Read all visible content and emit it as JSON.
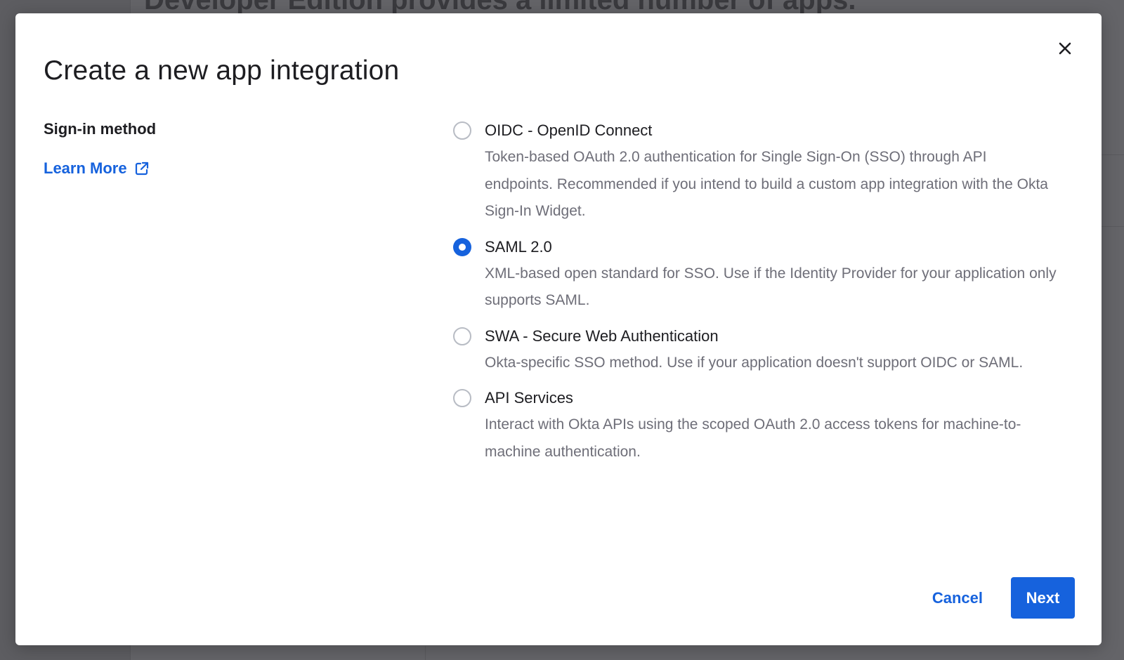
{
  "background": {
    "heading": "Developer Edition provides a limited number of apps."
  },
  "modal": {
    "title": "Create a new app integration",
    "close_icon": "close-icon",
    "sign_in": {
      "label": "Sign-in method",
      "learn_more": "Learn More",
      "learn_more_icon": "external-link-icon"
    },
    "options": [
      {
        "label": "OIDC - OpenID Connect",
        "description": "Token-based OAuth 2.0 authentication for Single Sign-On (SSO) through API endpoints. Recommended if you intend to build a custom app integration with the Okta Sign-In Widget.",
        "selected": false
      },
      {
        "label": "SAML 2.0",
        "description": "XML-based open standard for SSO. Use if the Identity Provider for your application only supports SAML.",
        "selected": true
      },
      {
        "label": "SWA - Secure Web Authentication",
        "description": "Okta-specific SSO method. Use if your application doesn't support OIDC or SAML.",
        "selected": false
      },
      {
        "label": "API Services",
        "description": "Interact with Okta APIs using the scoped OAuth 2.0 access tokens for machine-to-machine authentication.",
        "selected": false
      }
    ],
    "footer": {
      "cancel_label": "Cancel",
      "next_label": "Next"
    }
  },
  "colors": {
    "accent": "#1662dd",
    "text_primary": "#1d1d21",
    "text_secondary": "#6e6e78",
    "overlay": "#6b6b6f"
  }
}
